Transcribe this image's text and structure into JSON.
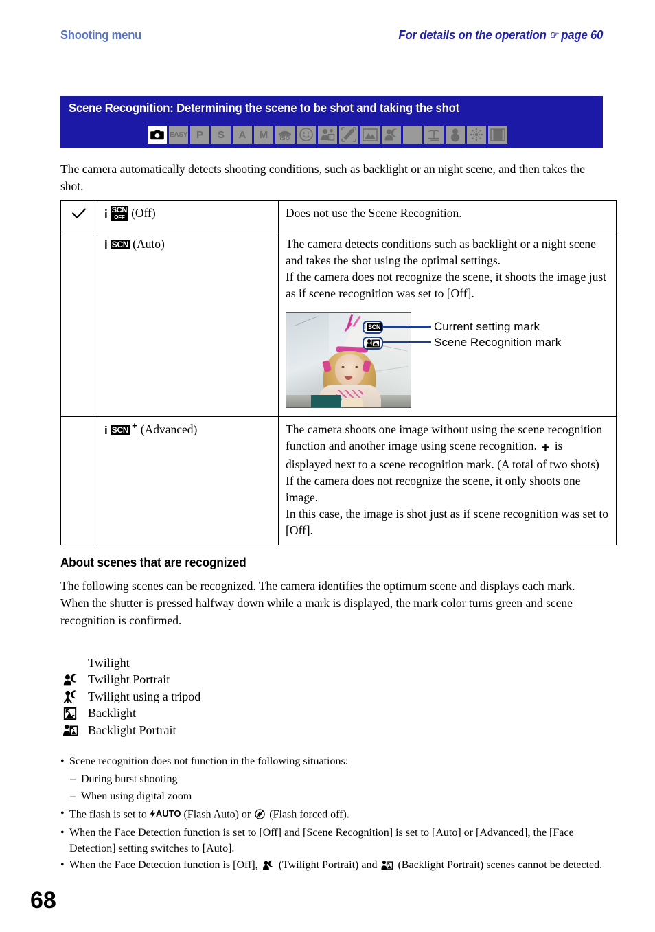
{
  "running_head": {
    "left": "Shooting menu",
    "right_text": "For details on the operation",
    "right_icon": "pointing-hand-icon",
    "right_page": "page 60",
    "left_color": "#5a74c8",
    "right_color": "#2222a8"
  },
  "band": {
    "title": "Scene Recognition: Determining the scene to be shot and taking the shot",
    "background_color": "#1b19a6",
    "modes": [
      {
        "name": "camera-auto-mode",
        "label": "",
        "icon": "camera-icon",
        "active": true
      },
      {
        "name": "easy-mode",
        "label": "EASY",
        "icon": "",
        "active": false
      },
      {
        "name": "program-mode",
        "label": "P",
        "icon": "",
        "active": false
      },
      {
        "name": "shutter-priority-mode",
        "label": "S",
        "icon": "",
        "active": false
      },
      {
        "name": "aperture-priority-mode",
        "label": "A",
        "icon": "",
        "active": false
      },
      {
        "name": "manual-mode",
        "label": "M",
        "icon": "",
        "active": false
      },
      {
        "name": "high-sensitivity-mode",
        "label": "ISO",
        "icon": "iso-icon",
        "active": false
      },
      {
        "name": "smile-shutter-mode",
        "label": "",
        "icon": "smile-icon",
        "active": false
      },
      {
        "name": "soft-snap-mode",
        "label": "",
        "icon": "portrait-icon",
        "active": false
      },
      {
        "name": "underwater-mode",
        "label": "",
        "icon": "snorkel-icon",
        "active": false
      },
      {
        "name": "landscape-mode",
        "label": "",
        "icon": "landscape-icon",
        "active": false
      },
      {
        "name": "twilight-portrait-mode",
        "label": "",
        "icon": "twilight-portrait-icon",
        "active": false
      },
      {
        "name": "twilight-mode",
        "label": "",
        "icon": "moon-icon",
        "active": false
      },
      {
        "name": "beach-mode",
        "label": "",
        "icon": "beach-icon",
        "active": false
      },
      {
        "name": "snow-mode",
        "label": "",
        "icon": "snowman-icon",
        "active": false
      },
      {
        "name": "fireworks-mode",
        "label": "",
        "icon": "fireworks-icon",
        "active": false
      },
      {
        "name": "movie-mode",
        "label": "",
        "icon": "film-icon",
        "active": false
      }
    ]
  },
  "intro": "The camera automatically detects shooting conditions, such as backlight or an night scene, and then takes the shot.",
  "table": {
    "rows": [
      {
        "checked": true,
        "icon_top": "SCN",
        "icon_bottom": "OFF",
        "option": "(Off)",
        "description": "Does not use the Scene Recognition."
      },
      {
        "checked": false,
        "icon_top": "SCN",
        "icon_bottom": "",
        "option": "(Auto)",
        "description": "The camera detects conditions such as backlight or a night scene and takes the shot using the optimal settings.\nIf the camera does not recognize the scene, it shoots the image just as if scene recognition was set to [Off]."
      },
      {
        "checked": false,
        "icon_top": "SCN",
        "icon_bottom": "",
        "plus": "+",
        "option": "(Advanced)",
        "description": "The camera shoots one image without using the scene recognition function and another image using scene recognition.",
        "description2": "is displayed next to a scene recognition mark. (A total of two shots)\nIf the camera does not recognize the scene, it only shoots one image.\nIn this case, the image is shot just as if scene recognition was set to [Off]."
      }
    ]
  },
  "photo_figure": {
    "alt": "camera-lcd-preview-photo-of-girl-with-party-hat",
    "osd_marks": [
      {
        "name": "current-setting-mark",
        "i": "i",
        "scn": "SCN"
      },
      {
        "name": "scene-recognition-mark",
        "i": "",
        "scn": ""
      }
    ],
    "callouts": [
      "Current setting mark",
      "Scene Recognition mark"
    ],
    "leader_color": "#1d3f8a"
  },
  "subhead": "About scenes that are recognized",
  "paragraph2": "The following scenes can be recognized. The camera identifies the optimum scene and displays each mark.\nWhen the shutter is pressed halfway down while a mark is displayed, the mark color turns green and scene recognition is confirmed.",
  "scene_list": [
    {
      "icon": "moon-icon",
      "label": "Twilight"
    },
    {
      "icon": "twilight-portrait-icon",
      "label": "Twilight Portrait"
    },
    {
      "icon": "tripod-twilight-icon",
      "label": "Twilight using a tripod"
    },
    {
      "icon": "backlight-icon",
      "label": "Backlight"
    },
    {
      "icon": "backlight-portrait-icon",
      "label": "Backlight Portrait"
    }
  ],
  "notes": {
    "n1": "Scene recognition does not function in the following situations:",
    "n1a": "During burst shooting",
    "n1b": "When using digital zoom",
    "n2_pre": "The flash is set to",
    "n2_flash_auto_label": "AUTO",
    "n2_mid": "(Flash Auto) or",
    "n2_post": "(Flash forced off).",
    "n3": "When the Face Detection function is set to [Off] and [Scene Recognition] is set to [Auto] or [Advanced], the [Face Detection] setting switches to [Auto].",
    "n4_pre": "When the Face Detection function is [Off],",
    "n4_mid": "(Twilight Portrait) and",
    "n4_post": "(Backlight Portrait) scenes cannot be detected."
  },
  "folio": "68"
}
